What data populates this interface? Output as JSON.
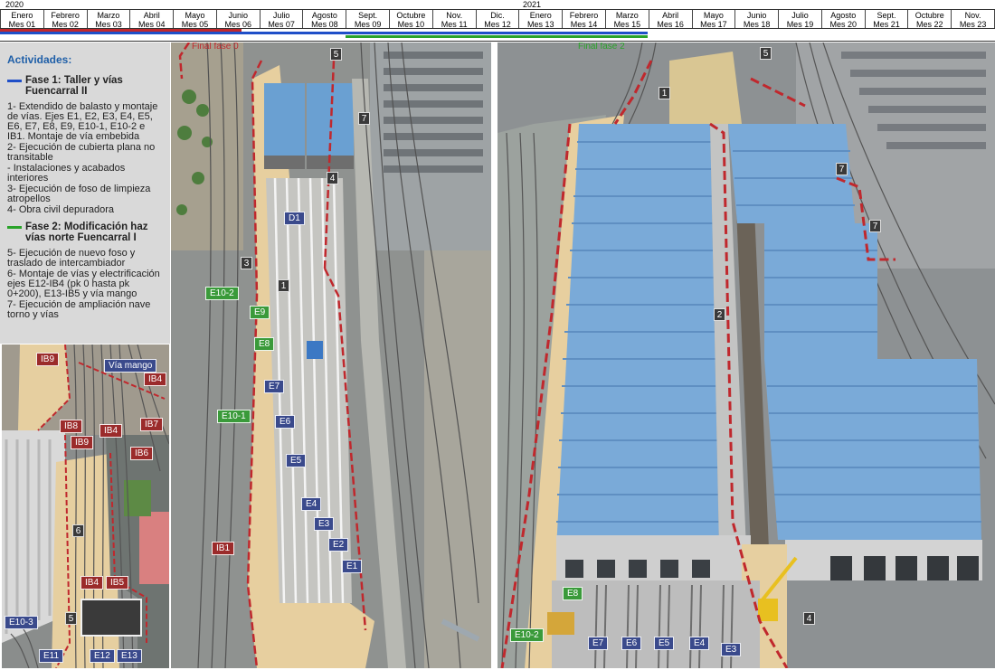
{
  "timeline": {
    "years": [
      "2020",
      "2021"
    ],
    "months": [
      {
        "name": "Enero",
        "num": "Mes 01"
      },
      {
        "name": "Febrero",
        "num": "Mes 02"
      },
      {
        "name": "Marzo",
        "num": "Mes 03"
      },
      {
        "name": "Abril",
        "num": "Mes 04"
      },
      {
        "name": "Mayo",
        "num": "Mes 05"
      },
      {
        "name": "Junio",
        "num": "Mes 06"
      },
      {
        "name": "Julio",
        "num": "Mes 07"
      },
      {
        "name": "Agosto",
        "num": "Mes 08"
      },
      {
        "name": "Sept.",
        "num": "Mes 09"
      },
      {
        "name": "Octubre",
        "num": "Mes 10"
      },
      {
        "name": "Nov.",
        "num": "Mes 11"
      },
      {
        "name": "Dic.",
        "num": "Mes 12"
      },
      {
        "name": "Enero",
        "num": "Mes 13"
      },
      {
        "name": "Febrero",
        "num": "Mes 14"
      },
      {
        "name": "Marzo",
        "num": "Mes 15"
      },
      {
        "name": "Abril",
        "num": "Mes 16"
      },
      {
        "name": "Mayo",
        "num": "Mes 17"
      },
      {
        "name": "Junio",
        "num": "Mes 18"
      },
      {
        "name": "Julio",
        "num": "Mes 19"
      },
      {
        "name": "Agosto",
        "num": "Mes 20"
      },
      {
        "name": "Sept.",
        "num": "Mes 21"
      },
      {
        "name": "Octubre",
        "num": "Mes 22"
      },
      {
        "name": "Nov.",
        "num": "Mes 23"
      }
    ],
    "colors": {
      "fase1": "#1f4fc8",
      "fase2": "#2aa32a",
      "final": "#c0282d"
    }
  },
  "legend": {
    "title": "Actividades:",
    "phases": [
      {
        "head": "Fase 1: Taller y vías Fuencarral II",
        "color": "#1f4fc8",
        "items": [
          "1- Extendido de balasto y montaje de vías. Ejes E1, E2, E3, E4, E5, E6, E7, E8, E9, E10-1, E10-2 e IB1. Montaje de vía embebida",
          "2- Ejecución de cubierta plana no transitable",
          "- Instalaciones y acabados interiores",
          "3- Ejecución de foso de limpieza atropellos",
          "4- Obra civil depuradora"
        ]
      },
      {
        "head": "Fase 2: Modificación haz vías norte Fuencarral I",
        "color": "#2aa32a",
        "items": [
          "5- Ejecución de nuevo foso y traslado de intercambiador",
          "6- Montaje de vías y electrificación ejes E12-IB4 (pk 0 hasta pk 0+200), E13-IB5 y vía mango",
          "7- Ejecución de ampliación nave torno y vías"
        ]
      }
    ]
  },
  "labels": {
    "final_fase_0": "Final fase 0",
    "final_fase_2": "Final fase 2"
  },
  "inset_tags": {
    "ib9_top": "IB9",
    "via_mango": "Vía mango",
    "ib4_top": "IB4",
    "ib8": "IB8",
    "ib4_mid": "IB4",
    "ib7": "IB7",
    "ib9_mid": "IB9",
    "ib6": "IB6",
    "num6": "6",
    "ib4_low": "IB4",
    "ib5": "IB5",
    "num5": "5",
    "e10_3": "E10-3",
    "e11": "E11",
    "e12": "E12",
    "e13": "E13"
  },
  "middle_tags": {
    "n5": "5",
    "n7": "7",
    "n4": "4",
    "d1": "D1",
    "n3": "3",
    "n1": "1",
    "e10_2": "E10-2",
    "e9": "E9",
    "e8": "E8",
    "e7": "E7",
    "e10_1": "E10-1",
    "e6": "E6",
    "e5": "E5",
    "e4": "E4",
    "e3": "E3",
    "e2": "E2",
    "e1": "E1",
    "ib1": "IB1"
  },
  "right_tags": {
    "n5": "5",
    "n1": "1",
    "n7a": "7",
    "n7b": "7",
    "n2": "2",
    "n4": "4",
    "e8": "E8",
    "e10_2": "E10-2",
    "e7": "E7",
    "e6": "E6",
    "e5": "E5",
    "e4": "E4",
    "e3": "E3"
  }
}
